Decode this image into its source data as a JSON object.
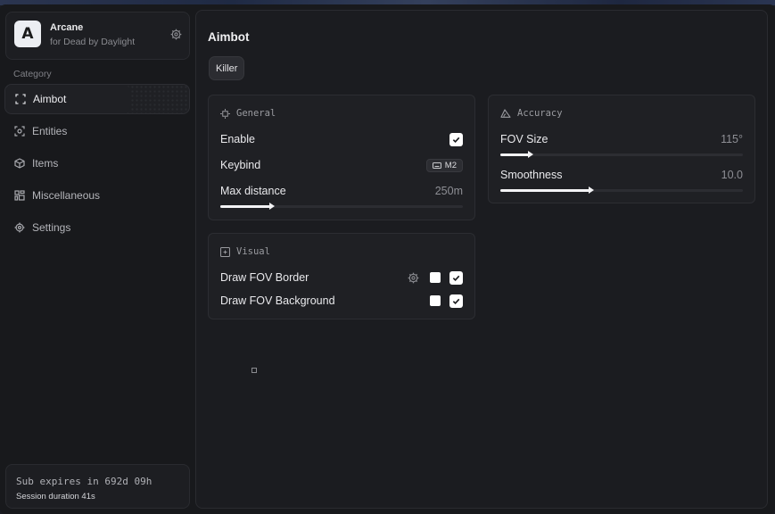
{
  "profile": {
    "avatar_letter": "A",
    "app_name": "Arcane",
    "app_subtitle": "for Dead by Daylight",
    "settings_icon": "gear-icon"
  },
  "sidebar": {
    "category_label": "Category",
    "items": [
      {
        "label": "Aimbot",
        "icon": "crosshair-frame-icon",
        "active": true
      },
      {
        "label": "Entities",
        "icon": "target-scan-icon",
        "active": false
      },
      {
        "label": "Items",
        "icon": "cube-icon",
        "active": false
      },
      {
        "label": "Miscellaneous",
        "icon": "grid-blocks-icon",
        "active": false
      },
      {
        "label": "Settings",
        "icon": "gear-icon",
        "active": false
      }
    ]
  },
  "subscription": {
    "expires_text": "Sub expires in 692d 09h",
    "session_text": "Session duration 41s"
  },
  "main": {
    "title": "Aimbot",
    "tabs": [
      {
        "label": "Killer",
        "selected": true
      }
    ],
    "general": {
      "title": "General",
      "enable_label": "Enable",
      "enable_checked": true,
      "keybind_label": "Keybind",
      "keybind_value": "M2",
      "max_distance_label": "Max distance",
      "max_distance_value": "250m",
      "max_distance_fraction": 0.21
    },
    "accuracy": {
      "title": "Accuracy",
      "fov_label": "FOV Size",
      "fov_value": "115°",
      "fov_fraction": 0.12,
      "smooth_label": "Smoothness",
      "smooth_value": "10.0",
      "smooth_fraction": 0.37
    },
    "visual": {
      "title": "Visual",
      "border_label": "Draw FOV Border",
      "border_color_checked": false,
      "border_checked": true,
      "background_label": "Draw FOV Background",
      "background_color_checked": false,
      "background_checked": true
    }
  },
  "colors": {
    "accent": "#f3f3f5",
    "background": "#18191c",
    "card": "#1f2024"
  }
}
